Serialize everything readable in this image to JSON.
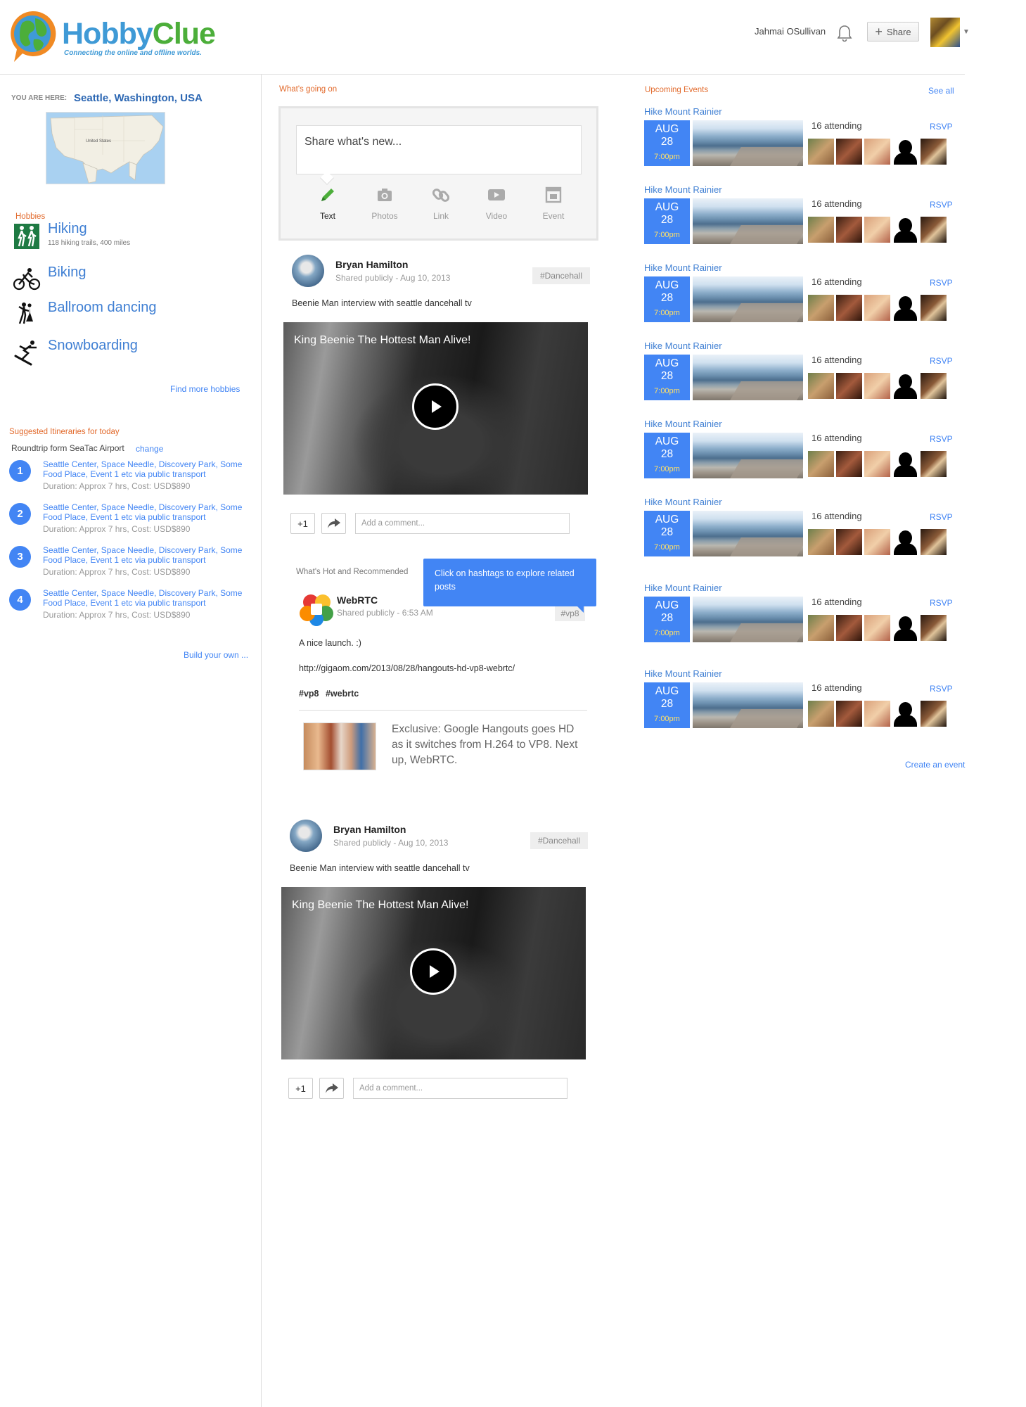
{
  "header": {
    "brand_part1": "Hobby",
    "brand_part2": "Clue",
    "tagline": "Connecting the online and offline worlds.",
    "user_name": "Jahmai OSullivan",
    "share_label": "Share",
    "colors": {
      "brand_blue": "#3f9ad6",
      "brand_green": "#4cae3a",
      "brand_orange": "#f08a24",
      "accent": "#4285f4"
    }
  },
  "location": {
    "label": "YOU ARE HERE:",
    "value": "Seattle, Washington, USA",
    "map_label": "United States"
  },
  "hobbies": {
    "title": "Hobbies",
    "items": [
      {
        "name": "Hiking",
        "sub": "118 hiking trails, 400 miles",
        "icon": "hiking-icon"
      },
      {
        "name": "Biking",
        "sub": "",
        "icon": "biking-icon"
      },
      {
        "name": "Ballroom dancing",
        "sub": "",
        "icon": "dancing-icon"
      },
      {
        "name": "Snowboarding",
        "sub": "",
        "icon": "snowboarding-icon"
      }
    ],
    "find_more": "Find more hobbies"
  },
  "itineraries": {
    "title": "Suggested Itineraries for today",
    "from": "Roundtrip form SeaTac Airport",
    "change": "change",
    "items": [
      {
        "num": "1",
        "places": "Seattle Center, Space Needle, Discovery Park, Some Food Place, Event 1  etc via public transport",
        "meta": "Duration: Approx 7 hrs, Cost: USD$890"
      },
      {
        "num": "2",
        "places": "Seattle Center, Space Needle, Discovery Park, Some Food Place, Event 1  etc via public transport",
        "meta": "Duration: Approx 7 hrs, Cost: USD$890"
      },
      {
        "num": "3",
        "places": "Seattle Center, Space Needle, Discovery Park, Some Food Place, Event 1  etc via public transport",
        "meta": "Duration: Approx 7 hrs, Cost: USD$890"
      },
      {
        "num": "4",
        "places": "Seattle Center, Space Needle, Discovery Park, Some Food Place, Event 1  etc via public transport",
        "meta": "Duration: Approx 7 hrs, Cost: USD$890"
      }
    ],
    "build_own": "Build your own ..."
  },
  "feed": {
    "title": "What's going on",
    "composer": {
      "placeholder": "Share what's new...",
      "tools": [
        {
          "label": "Text",
          "icon": "pencil-icon"
        },
        {
          "label": "Photos",
          "icon": "camera-icon"
        },
        {
          "label": "Link",
          "icon": "link-icon"
        },
        {
          "label": "Video",
          "icon": "video-icon"
        },
        {
          "label": "Event",
          "icon": "calendar-icon"
        }
      ]
    },
    "posts": [
      {
        "author": "Bryan Hamilton",
        "visibility": "Shared publicly",
        "date": "Aug 10, 2013",
        "tag": "#Dancehall",
        "text": "Beenie Man interview with seattle dancehall tv",
        "video_title": "King Beenie The Hottest Man Alive!",
        "plus_one": "+1",
        "comment_placeholder": "Add a comment..."
      },
      {
        "author": "Bryan Hamilton",
        "visibility": "Shared publicly",
        "date": "Aug 10, 2013",
        "tag": "#Dancehall",
        "text": "Beenie Man interview with seattle dancehall tv",
        "video_title": "King Beenie The Hottest Man Alive!",
        "plus_one": "+1",
        "comment_placeholder": "Add a comment..."
      }
    ],
    "hot": {
      "title": "What's Hot and Recommended",
      "tooltip": "Click on hashtags to explore related posts",
      "author": "WebRTC",
      "visibility": "Shared publicly",
      "time": "6:53 AM",
      "tag": "#vp8",
      "text": "A nice launch. :)",
      "url": "http://gigaom.com/2013/08/28/hangouts-hd-vp8-webrtc/",
      "hashtags": "#vp8 #webrtc",
      "snippet": "Exclusive: Google Hangouts goes HD as it switches from H.264 to VP8. Next up, WebRTC."
    }
  },
  "events": {
    "title": "Upcoming Events",
    "see_all": "See all",
    "items": [
      {
        "title": "Hike Mount Rainier",
        "month": "AUG",
        "day": "28",
        "time": "7:00pm",
        "attending": "16 attending",
        "rsvp": "RSVP"
      },
      {
        "title": "Hike Mount Rainier",
        "month": "AUG",
        "day": "28",
        "time": "7:00pm",
        "attending": "16 attending",
        "rsvp": "RSVP"
      },
      {
        "title": "Hike Mount Rainier",
        "month": "AUG",
        "day": "28",
        "time": "7:00pm",
        "attending": "16 attending",
        "rsvp": "RSVP"
      },
      {
        "title": "Hike Mount Rainier",
        "month": "AUG",
        "day": "28",
        "time": "7:00pm",
        "attending": "16 attending",
        "rsvp": "RSVP"
      },
      {
        "title": "Hike Mount Rainier",
        "month": "AUG",
        "day": "28",
        "time": "7:00pm",
        "attending": "16 attending",
        "rsvp": "RSVP"
      },
      {
        "title": "Hike Mount Rainier",
        "month": "AUG",
        "day": "28",
        "time": "7:00pm",
        "attending": "16 attending",
        "rsvp": "RSVP"
      },
      {
        "title": "Hike Mount Rainier",
        "month": "AUG",
        "day": "28",
        "time": "7:00pm",
        "attending": "16 attending",
        "rsvp": "RSVP"
      },
      {
        "title": "Hike Mount Rainier",
        "month": "AUG",
        "day": "28",
        "time": "7:00pm",
        "attending": "16 attending",
        "rsvp": "RSVP"
      }
    ],
    "create": "Create an event"
  }
}
